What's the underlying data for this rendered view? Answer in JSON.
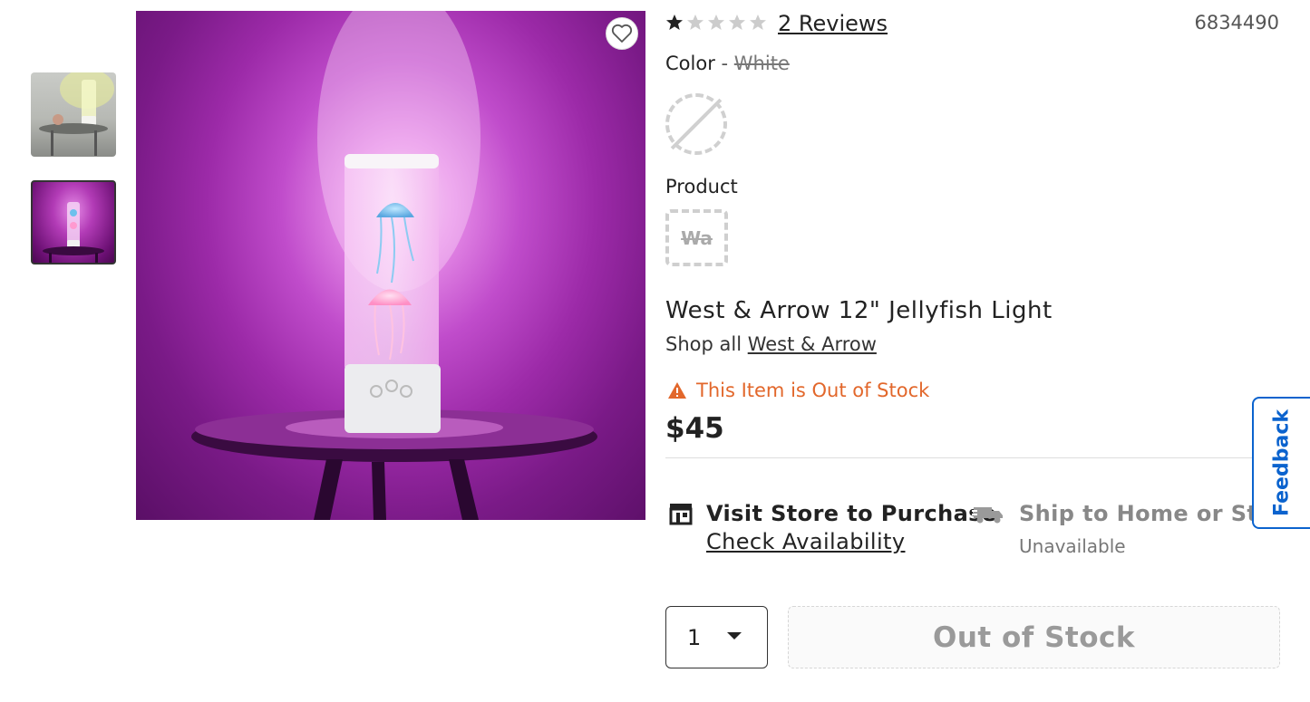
{
  "gallery": {
    "thumbnails": [
      {
        "name": "thumbnail-white-lamp",
        "selected": false
      },
      {
        "name": "thumbnail-purple-lamp",
        "selected": true
      }
    ],
    "favorite_icon": "heart-icon"
  },
  "rating": {
    "stars_filled": 1,
    "stars_total": 5,
    "reviews_text": "2 Reviews"
  },
  "sku": "6834490",
  "color": {
    "label": "Color",
    "separator": "-",
    "value": "White"
  },
  "product": {
    "label": "Product",
    "chip_text": "Wa"
  },
  "title": "West & Arrow 12\" Jellyfish Light",
  "brand": {
    "prefix": "Shop all",
    "link": "West & Arrow"
  },
  "stock_warning": "This Item is Out of Stock",
  "price": "$45",
  "fulfillment": {
    "store": {
      "title": "Visit Store to Purchase",
      "link": "Check Availability",
      "icon": "store-icon"
    },
    "ship": {
      "title": "Ship to Home or Store",
      "status": "Unavailable",
      "icon": "truck-icon"
    }
  },
  "quantity": "1",
  "cta_label": "Out of Stock",
  "feedback_label": "Feedback",
  "colors": {
    "warning": "#e2672b",
    "feedback": "#0b63ce",
    "hero_purple": "#9c2aa8"
  }
}
